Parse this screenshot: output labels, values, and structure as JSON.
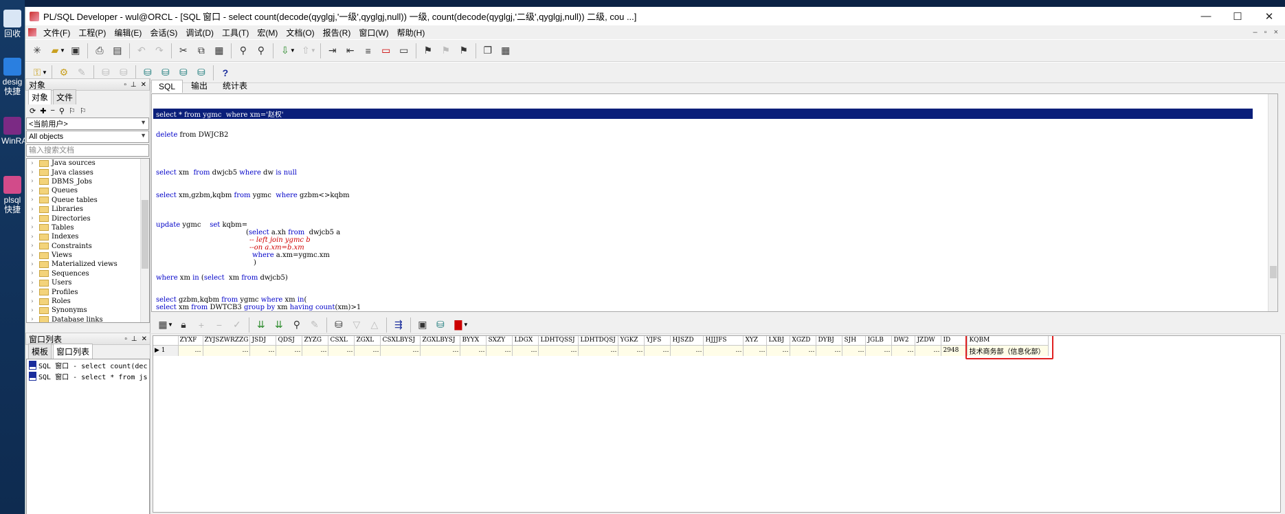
{
  "desktop": {
    "icons": [
      {
        "label": "回收",
        "icon": "recycle-bin-icon",
        "color": "#d9e6f5"
      },
      {
        "label": "desig\n快捷",
        "icon": "shortcut-icon",
        "color": "#2a7fe0"
      },
      {
        "label": "WinRA",
        "icon": "winrar-icon",
        "color": "#7b2a84"
      },
      {
        "label": "plsql\n快捷",
        "icon": "plsql-icon",
        "color": "#d24b8a"
      }
    ]
  },
  "window": {
    "title": "PL/SQL Developer - wul@ORCL - [SQL 窗口 - select count(decode(qyglgj,'一级',qyglgj,null)) 一级, count(decode(qyglgj,'二级',qyglgj,null)) 二级, cou ...]",
    "controls": {
      "minimize": "—",
      "maximize": "☐",
      "close": "✕"
    }
  },
  "menu": [
    "文件(F)",
    "工程(P)",
    "编辑(E)",
    "会话(S)",
    "调试(D)",
    "工具(T)",
    "宏(M)",
    "文档(O)",
    "报告(R)",
    "窗口(W)",
    "帮助(H)"
  ],
  "mdi_controls": [
    "–",
    "▫",
    "×"
  ],
  "left_panel": {
    "object_header": "对象",
    "tabs": [
      "对象",
      "文件"
    ],
    "user_combo": "<当前用户>",
    "objects_combo": "All objects",
    "filter_placeholder": "输入搜索文档",
    "tree": [
      "Java sources",
      "Java classes",
      "DBMS_Jobs",
      "Queues",
      "Queue tables",
      "Libraries",
      "Directories",
      "Tables",
      "Indexes",
      "Constraints",
      "Views",
      "Materialized views",
      "Sequences",
      "Users",
      "Profiles",
      "Roles",
      "Synonyms",
      "Database links"
    ],
    "window_list_header": "窗口列表",
    "window_list_tabs": [
      "模板",
      "窗口列表"
    ],
    "window_list_items": [
      "SQL 窗口 - select count(dec",
      "SQL 窗口 - select * from js"
    ]
  },
  "editor": {
    "tabs": [
      "SQL",
      "输出",
      "统计表"
    ],
    "lines": {
      "l1": "select * from ygmc  where xm='赵权'",
      "l2a": "delete",
      "l2b": " from DWJCB2",
      "l3a": "select",
      "l3b": " xm  ",
      "l3c": "from",
      "l3d": " dwjcb5 ",
      "l3e": "where",
      "l3f": " dw ",
      "l3g": "is null",
      "l4a": "select",
      "l4b": " xm,gzbm,kqbm ",
      "l4c": "from",
      "l4d": " ygmc  ",
      "l4e": "where",
      "l4f": " gzbm<>kqbm",
      "l5a": "update",
      "l5b": " ygmc    ",
      "l5c": "set",
      "l5d": " kqbm=",
      "l6a": "(",
      "l6b": "select",
      "l6c": " a.xh ",
      "l6d": "from",
      "l6e": "  dwjcb5 a",
      "l7": "-- left join ygmc b",
      "l8": "--on a.xm=b.xm",
      "l9a": "where",
      "l9b": " a.xm=ygmc.xm",
      "l10": ")",
      "l11a": "where",
      "l11b": " xm ",
      "l11c": "in",
      "l11d": " (",
      "l11e": "select",
      "l11f": "  xm ",
      "l11g": "from",
      "l11h": " dwjcb5)",
      "l12a": "select",
      "l12b": " gzbm,kqbm ",
      "l12c": "from",
      "l12d": " ygmc ",
      "l12e": "where",
      "l12f": " xm ",
      "l12g": "in",
      "l12h": "(",
      "l13a": "select",
      "l13b": " xm ",
      "l13c": "from",
      "l13d": " DWTCB3 ",
      "l13e": "group by",
      "l13f": " xm ",
      "l13g": "having count",
      "l13h": "(xm)>1"
    }
  },
  "grid": {
    "columns": [
      "ZYXF",
      "ZYJSZWRZZG",
      "JSDJ",
      "QDSJ",
      "ZYZG",
      "CSXL",
      "ZGXL",
      "CSXLBYSJ",
      "ZGXLBYSJ",
      "BYYX",
      "SXZY",
      "LDGX",
      "LDHTQSSJ",
      "LDHTDQSJ",
      "YGKZ",
      "YJFS",
      "HJSZD",
      "HJJJFS",
      "XYZ",
      "LXBJ",
      "XGZD",
      "DYBJ",
      "SJH",
      "JGLB",
      "DW2",
      "JZDW",
      "ID",
      "KQBM"
    ],
    "row_number": "1",
    "row": [
      "…",
      "…",
      "…",
      "…",
      "…",
      "…",
      "…",
      "…",
      "…",
      "…",
      "…",
      "…",
      "…",
      "…",
      "…",
      "…",
      "…",
      "…",
      "…",
      "…",
      "…",
      "…",
      "…",
      "…",
      "…",
      "…",
      "2948",
      "技术商务部（信息化部）"
    ],
    "highlight_color": "#e02020"
  }
}
